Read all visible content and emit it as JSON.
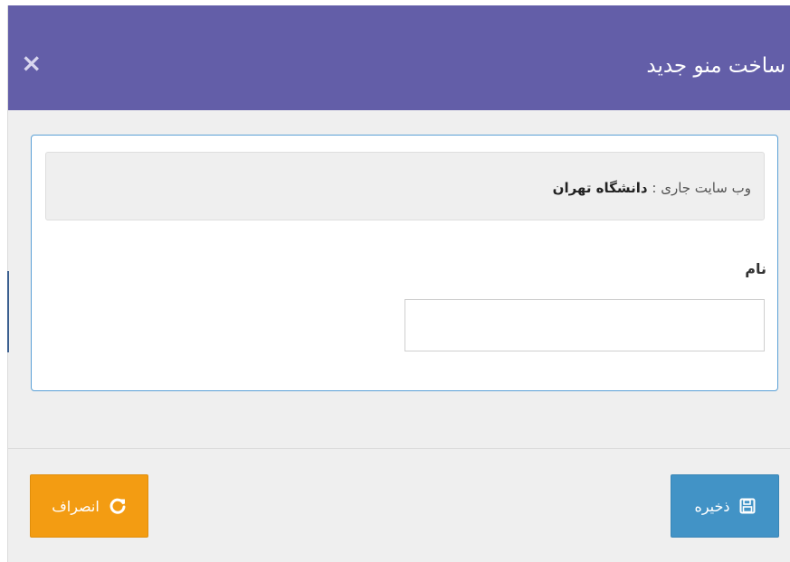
{
  "dialog": {
    "title": "ساخت منو جدید",
    "close_symbol": "×"
  },
  "info": {
    "label": "وب سایت جاری : ",
    "site_name": "دانشگاه تهران"
  },
  "form": {
    "name_label": "نام",
    "name_value": "",
    "name_placeholder": ""
  },
  "buttons": {
    "save_label": "ذخیره",
    "save_icon": "floppy-disk-icon",
    "cancel_label": "انصراف",
    "cancel_icon": "refresh-icon"
  },
  "colors": {
    "header": "#635ea8",
    "panel_border": "#5aa0d6",
    "save": "#4293c6",
    "cancel": "#f39c12"
  }
}
